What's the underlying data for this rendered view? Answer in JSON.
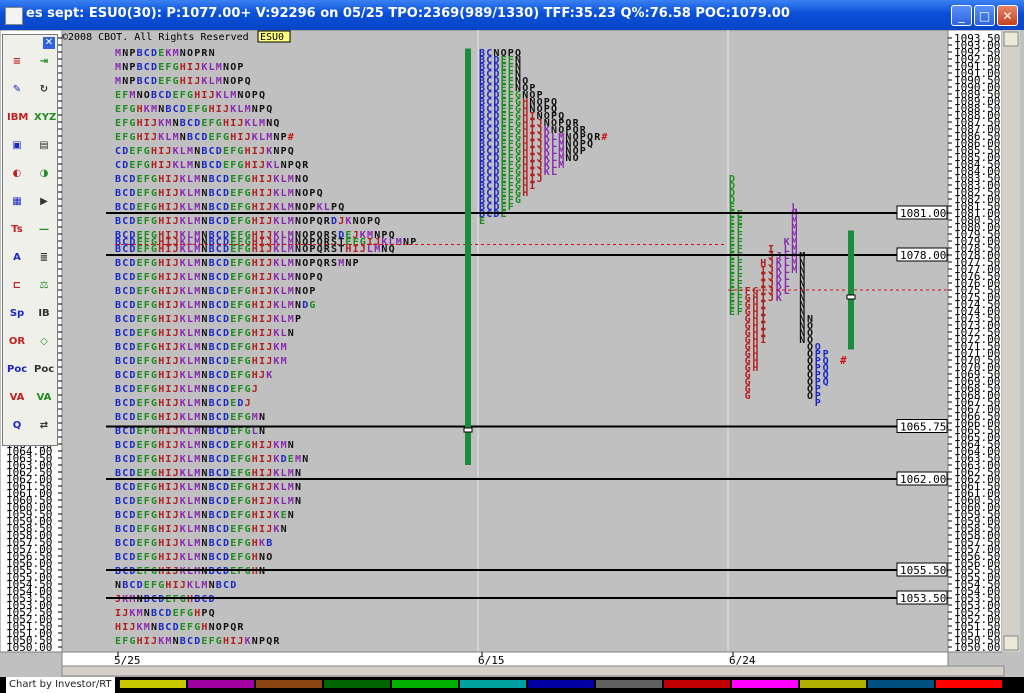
{
  "window": {
    "title": "es sept: ESU0(30): P:1077.00+ V:92296 on 05/25 TPO:2369(989/1330) TFF:35.23 Q%:76.58 POC:1079.00",
    "minimize": "_",
    "maximize": "□",
    "close": "✕"
  },
  "copyright": "©2008 CBOT. All Rights Reserved",
  "symbol_tag": "ESU0",
  "status_text": "Chart by Investor/RT",
  "toolbox": {
    "close": "✕",
    "tools": [
      "≡",
      "⇥",
      "✎",
      "↻",
      "IBM",
      "XYZ",
      "▣",
      "▤",
      "◐",
      "◑",
      "▦",
      "▶",
      "Ts",
      "—",
      "A",
      "≣",
      "⊏",
      "⚖",
      "Sp",
      "IB",
      "OR",
      "◇",
      "Poc",
      "Poc",
      "VA",
      "VA",
      "Q",
      "⇄"
    ]
  },
  "colors": {
    "profile_bg": "#c0c0c0",
    "letter_red": "#b02020",
    "letter_green": "#1e8c1e",
    "letter_blue": "#1a28c8",
    "letter_purple": "#8a2ab0",
    "letter_black": "#111111",
    "green_bar": "#1a8c3c",
    "poc_line": "#d01010"
  },
  "chart_data": {
    "type": "market-profile",
    "ylim": [
      1050.0,
      1093.5
    ],
    "y_tick_step": 0.5,
    "y_label_step": 1.0,
    "x_labels": [
      "5/25",
      "6/15",
      "6/24"
    ],
    "levels": [
      {
        "price": 1081.0,
        "label": "1081.00"
      },
      {
        "price": 1078.0,
        "label": "1078.00"
      },
      {
        "price": 1065.75,
        "label": "1065.75"
      },
      {
        "price": 1062.0,
        "label": "1062.00"
      },
      {
        "price": 1055.5,
        "label": "1055.50"
      },
      {
        "price": 1053.5,
        "label": "1053.50"
      }
    ],
    "poc_marks": [
      {
        "price": 1078.75,
        "session": "5/25"
      },
      {
        "price": 1075.5,
        "session": "6/24"
      }
    ],
    "range_bars": [
      {
        "session": "6/15",
        "high": 1092.75,
        "low": 1063.0,
        "marker": 1065.5
      },
      {
        "session": "6/24",
        "high": 1079.75,
        "low": 1071.25,
        "marker": 1075.0
      }
    ],
    "composite_profile": {
      "session": "5/25",
      "rows": [
        {
          "price": 1092.5,
          "text": "MNPBCDEKMNOPRN"
        },
        {
          "price": 1091.5,
          "text": "MNPBCDEFGHIJKLMNOP"
        },
        {
          "price": 1090.5,
          "text": "MNPBCDEFGHIJKLMNOPQ"
        },
        {
          "price": 1089.5,
          "text": "EFMNOBCDEFGHIJKLMNOPQ"
        },
        {
          "price": 1088.5,
          "text": "EFGHKMNBCDEFGHIJKLMNPQ"
        },
        {
          "price": 1087.5,
          "text": "EFGHIJKMNBCDEFGHIJKLMNQ"
        },
        {
          "price": 1086.5,
          "text": "EFGHIJKLMNBCDEFGHIJKLMNP#"
        },
        {
          "price": 1085.5,
          "text": "CDEFGHIJKLMNBCDEFGHIJKNPQ"
        },
        {
          "price": 1084.5,
          "text": "CDEFGHIJKLMNBCDEFGHIJKLNPQR"
        },
        {
          "price": 1083.5,
          "text": "BCDEFGHIJKLMNBCDEFGHIJKLMNO"
        },
        {
          "price": 1082.5,
          "text": "BCDEFGHIJKLMNBCDEFGHIJKLMNOPQ"
        },
        {
          "price": 1081.5,
          "text": "BCDEFGHIJKLMNBCDEFGHIJKLMNOPKLPQ"
        },
        {
          "price": 1080.5,
          "text": "BCDEFGHIJKLMNBCDEFGHIJKLMNOPQRDJKNOPQ"
        },
        {
          "price": 1079.5,
          "text": "BCDEFGHIJKLMNBCDEFGHIJKLMNOPQRSDEJKMNPQ"
        },
        {
          "price": 1079.0,
          "text": "BCDEFGHIJKLMNBCDEFGHIJKLMNOPQRSTEFGIJKLMNP"
        },
        {
          "price": 1078.5,
          "text": "BCDEFGHIJKLMNBCDEFGHIJKLMNOPQRSTHIJLMNQ"
        },
        {
          "price": 1077.5,
          "text": "BCDEFGHIJKLMNBCDEFGHIJKLMNOPQRSMNP"
        },
        {
          "price": 1076.5,
          "text": "BCDEFGHIJKLMNBCDEFGHIJKLMNOPQ"
        },
        {
          "price": 1075.5,
          "text": "BCDEFGHIJKLMNBCDEFGHIJKLMNOP"
        },
        {
          "price": 1074.5,
          "text": "BCDEFGHIJKLMNBCDEFGHIJKLMNDG"
        },
        {
          "price": 1073.5,
          "text": "BCDEFGHIJKLMNBCDEFGHIJKLMP"
        },
        {
          "price": 1072.5,
          "text": "BCDEFGHIJKLMNBCDEFGHIJKLN"
        },
        {
          "price": 1071.5,
          "text": "BCDEFGHIJKLMNBCDEFGHIJKM"
        },
        {
          "price": 1070.5,
          "text": "BCDEFGHIJKLMNBCDEFGHIJKM"
        },
        {
          "price": 1069.5,
          "text": "BCDEFGHIJKLMNBCDEFGHJK"
        },
        {
          "price": 1068.5,
          "text": "BCDEFGHIJKLMNBCDEFGJ"
        },
        {
          "price": 1067.5,
          "text": "BCDEFGHIJKLMNBCDEDJ"
        },
        {
          "price": 1066.5,
          "text": "BCDEFGHIJKLMNBCDEFGMN"
        },
        {
          "price": 1065.5,
          "text": "BCDEFGHIJKLMNBCDEFGLN"
        },
        {
          "price": 1064.5,
          "text": "BCDEFGHIJKLMNBCDEFGHIJKMN"
        },
        {
          "price": 1063.5,
          "text": "BCDEFGHIJKLMNBCDEFGHIJKDEMN"
        },
        {
          "price": 1062.5,
          "text": "BCDEFGHIJKLMNBCDEFGHIJKLMN"
        },
        {
          "price": 1061.5,
          "text": "BCDEFGHIJKLMNBCDEFGHIJKLMN"
        },
        {
          "price": 1060.5,
          "text": "BCDEFGHIJKLMNBCDEFGHIJKLMN"
        },
        {
          "price": 1059.5,
          "text": "BCDEFGHIJKLMNBCDEFGHIJKEN"
        },
        {
          "price": 1058.5,
          "text": "BCDEFGHIJKLMNBCDEFGHIJKN"
        },
        {
          "price": 1057.5,
          "text": "BCDEFGHIJKLMNBCDEFGHKB"
        },
        {
          "price": 1056.5,
          "text": "BCDEFGHIJKLMNBCDEFGHNO"
        },
        {
          "price": 1055.5,
          "text": "BCDEFGHIJKLMNBCDEFGHN"
        },
        {
          "price": 1054.5,
          "text": "NBCDEFGHIJKLMNBCD"
        },
        {
          "price": 1053.5,
          "text": "JKMNBCDEFGHBCD"
        },
        {
          "price": 1052.5,
          "text": "IJKMNBCDEFGHPQ"
        },
        {
          "price": 1051.5,
          "text": "HIJKMNBCDEFGHNOPQR"
        },
        {
          "price": 1050.5,
          "text": "EFGHIJKMNBCDEFGHIJKNPQR"
        }
      ]
    },
    "profile_615": {
      "session": "6/15",
      "rows": [
        {
          "price": 1092.5,
          "text": "BCNOPQ"
        },
        {
          "price": 1092.0,
          "text": "BCDEFN"
        },
        {
          "price": 1091.5,
          "text": "BCDEFN"
        },
        {
          "price": 1091.0,
          "text": "BCDEFN"
        },
        {
          "price": 1090.5,
          "text": "BCDEFNO"
        },
        {
          "price": 1090.0,
          "text": "BCDEFNOP"
        },
        {
          "price": 1089.5,
          "text": "BCDEFGNOP"
        },
        {
          "price": 1089.0,
          "text": "BCDEFGHNOPQ"
        },
        {
          "price": 1088.5,
          "text": "BCDEFGHNOPQ"
        },
        {
          "price": 1088.0,
          "text": "BCDEFGHINOPQ"
        },
        {
          "price": 1087.5,
          "text": "BCDEFGHIJNOPQR"
        },
        {
          "price": 1087.0,
          "text": "BCDEFGHIJKNOPQR"
        },
        {
          "price": 1086.5,
          "text": "BCDEFGHIJKLMNOPQR#"
        },
        {
          "price": 1086.0,
          "text": "BCDEFGHIJKLMNOPQ"
        },
        {
          "price": 1085.5,
          "text": "BCDEFGHIJKLMNOP"
        },
        {
          "price": 1085.0,
          "text": "BCDEFGHIJKLMNO"
        },
        {
          "price": 1084.5,
          "text": "BCDEFGHIJKLM"
        },
        {
          "price": 1084.0,
          "text": "BCDEFGHIJKL"
        },
        {
          "price": 1083.5,
          "text": "BCDEFGHIJ"
        },
        {
          "price": 1083.0,
          "text": "BCDEFGHI"
        },
        {
          "price": 1082.5,
          "text": "BCDEFGH"
        },
        {
          "price": 1082.0,
          "text": "BCDEFG"
        },
        {
          "price": 1081.5,
          "text": "BCDEF"
        },
        {
          "price": 1081.0,
          "text": "BCDE"
        },
        {
          "price": 1080.5,
          "text": "E"
        }
      ]
    },
    "profile_624_a": {
      "session": "6/24",
      "columns": [
        {
          "x_offset": 0,
          "letters": "DDDDEEEEEEEEEEEEEEEE",
          "top": 1083.5,
          "color": "green"
        },
        {
          "x_offset": 1,
          "letters": "EEFFFFFFFFFFFFF",
          "top": 1081.0,
          "color": "green"
        },
        {
          "x_offset": 2,
          "letters": "FGGGGGGGGGGGGGGG",
          "top": 1075.5,
          "color": "red"
        },
        {
          "x_offset": 3,
          "letters": "GHHHHHHHHHHH",
          "top": 1075.5,
          "color": "red"
        },
        {
          "x_offset": 4,
          "letters": "HIIIIIIIIIII",
          "top": 1077.5,
          "color": "red"
        },
        {
          "x_offset": 5,
          "letters": "IJJJJJJJ",
          "top": 1078.5,
          "color": "red"
        },
        {
          "x_offset": 6,
          "letters": "JKKKKKK",
          "top": 1078.0,
          "color": "purple"
        },
        {
          "x_offset": 7,
          "letters": "KLLLLLLL",
          "top": 1079.0,
          "color": "purple"
        },
        {
          "x_offset": 8,
          "letters": "LMMMMMMMMM",
          "top": 1081.5,
          "color": "purple"
        },
        {
          "x_offset": 9,
          "letters": "MNNNNNNNNNNNN",
          "top": 1078.0,
          "color": "black"
        },
        {
          "x_offset": 10,
          "letters": "NOOOOOOOOOOO",
          "top": 1073.5,
          "color": "black"
        },
        {
          "x_offset": 11,
          "letters": "OPPPPPPPP",
          "top": 1071.5,
          "color": "blue"
        },
        {
          "x_offset": 12,
          "letters": "PQQQQ",
          "top": 1071.0,
          "color": "blue"
        }
      ],
      "marks": [
        {
          "price": 1070.5,
          "text": "#"
        }
      ]
    }
  }
}
